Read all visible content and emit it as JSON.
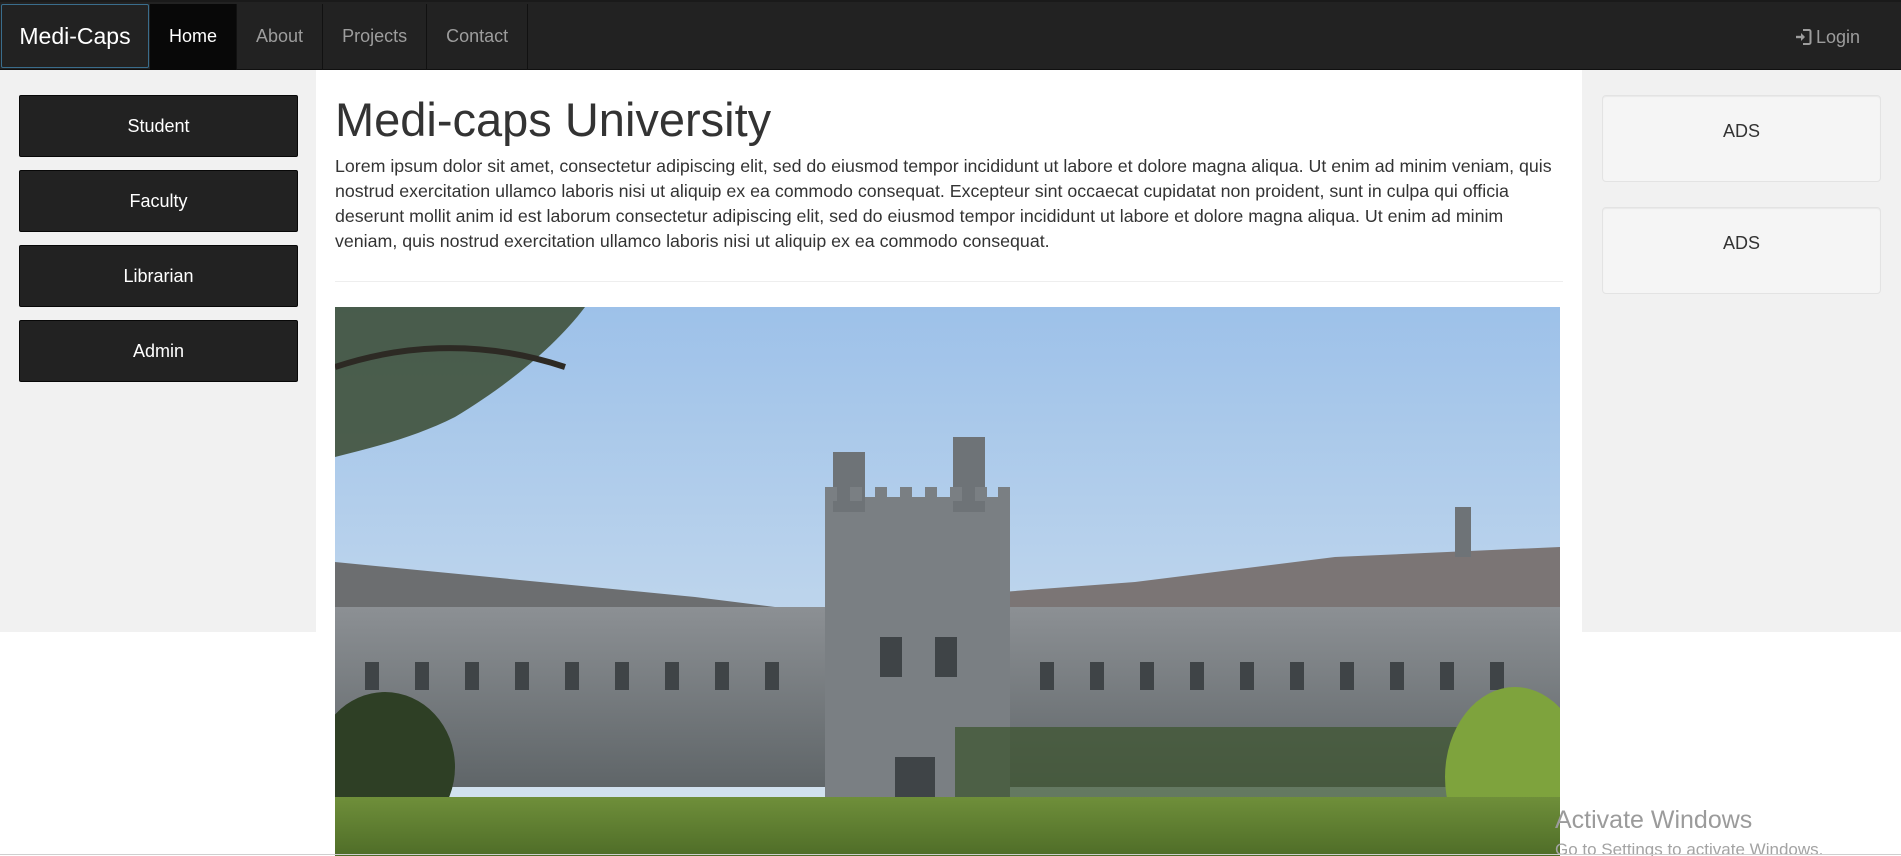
{
  "navbar": {
    "brand": "Medi-Caps",
    "items": [
      {
        "label": "Home",
        "active": true
      },
      {
        "label": "About",
        "active": false
      },
      {
        "label": "Projects",
        "active": false
      },
      {
        "label": "Contact",
        "active": false
      }
    ],
    "login_label": "Login",
    "login_icon": "log-in-icon",
    "background": "#222222"
  },
  "sidebar": {
    "buttons": [
      {
        "label": "Student"
      },
      {
        "label": "Faculty"
      },
      {
        "label": "Librarian"
      },
      {
        "label": "Admin"
      }
    ]
  },
  "main": {
    "title": "Medi-caps University",
    "paragraph": "Lorem ipsum dolor sit amet, consectetur adipiscing elit, sed do eiusmod tempor incididunt ut labore et dolore magna aliqua. Ut enim ad minim veniam, quis nostrud exercitation ullamco laboris nisi ut aliquip ex ea commodo consequat. Excepteur sint occaecat cupidatat non proident, sunt in culpa qui officia deserunt mollit anim id est laborum consectetur adipiscing elit, sed do eiusmod tempor incididunt ut labore et dolore magna aliqua. Ut enim ad minim veniam, quis nostrud exercitation ullamco laboris nisi ut aliquip ex ea commodo consequat."
  },
  "ads": [
    {
      "label": "ADS"
    },
    {
      "label": "ADS"
    }
  ],
  "watermark": {
    "title": "Activate Windows",
    "subtitle": "Go to Settings to activate Windows."
  }
}
